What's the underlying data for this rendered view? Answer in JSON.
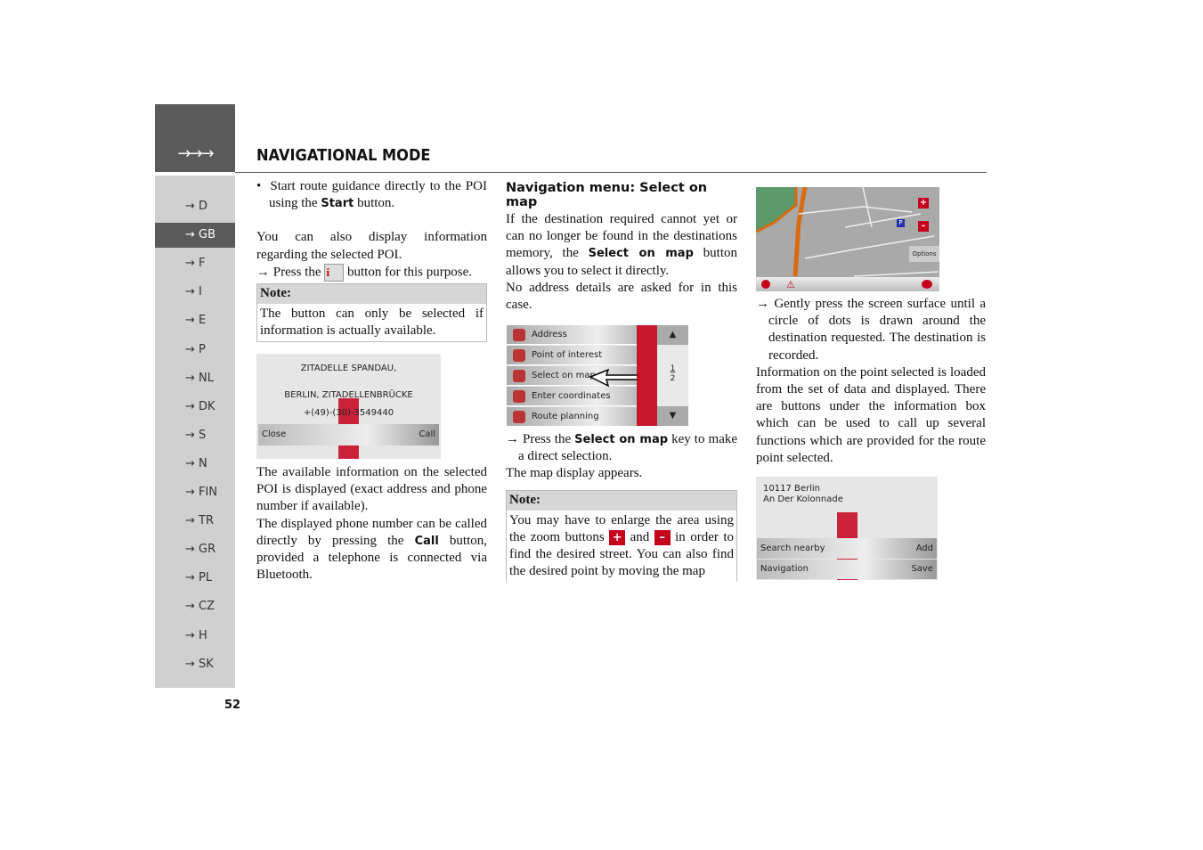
{
  "header": {
    "arrows": "→→→",
    "title": "NAVIGATIONAL MODE"
  },
  "sidebar": {
    "items": [
      "→ D",
      "→ GB",
      "→ F",
      "→ I",
      "→ E",
      "→ P",
      "→ NL",
      "→ DK",
      "→ S",
      "→ N",
      "→ FIN",
      "→ TR",
      "→ GR",
      "→ PL",
      "→ CZ",
      "→ H",
      "→ SK"
    ],
    "active": "→ GB"
  },
  "page_number": "52",
  "col1": {
    "bullet_pre": "Start route guidance directly to the POI using the ",
    "bullet_bold": "Start",
    "bullet_post": " button.",
    "p1": "You can also display information regarding the selected POI.",
    "p2_pre": "→ Press the ",
    "info_icon": "i",
    "p2_post": " button for this purpose.",
    "note_title": "Note:",
    "note_body": "The button can only be selected if information is actually available.",
    "poi_box": {
      "line1": "ZITADELLE SPANDAU,",
      "line2": "BERLIN, ZITADELLENBRÜCKE",
      "phone": "+(49)-(30)-3549440",
      "close": "Close",
      "call": "Call"
    },
    "p3": "The available information on the selected POI is displayed (exact address and phone number if available).",
    "p4_pre": "The displayed phone number can be called directly by pressing the ",
    "p4_bold": "Call",
    "p4_post": " button, provided a telephone is connected via Bluetooth."
  },
  "col2": {
    "heading": "Navigation menu: Select on map",
    "p1_pre": "If the destination required cannot yet or can no longer be found in the destinations memory, the ",
    "p1_bold": "Select on map",
    "p1_post": " button allows you to select it directly.",
    "p2": "No address details are asked for in this case.",
    "menu": {
      "items": [
        "Address",
        "Point of interest",
        "Select on map",
        "Enter coordinates",
        "Route planning"
      ],
      "page": "1",
      "pages": "2",
      "up": "▲",
      "down": "▼"
    },
    "step_pre": "→ Press the ",
    "step_bold": "Select on map",
    "step_post": " key to make a direct selection.",
    "p3": "The map display appears.",
    "note_title": "Note:",
    "note_pre": "You may have to enlarge the area using the zoom buttons ",
    "plus": "+",
    "note_and": " and ",
    "minus": "–",
    "note_post": " in order to find the desired street. You can also find the desired point by moving the map"
  },
  "col3": {
    "map": {
      "options": "Options",
      "plus": "+",
      "minus": "–",
      "parking": "P"
    },
    "step": "→ Gently press the screen surface until a circle of dots is drawn around the destination requested. The destination is recorded.",
    "p1": "Information on the point selected is loaded from the set of data and displayed. There are buttons under the information box which can be used to call up several functions which are provided for the route point selected.",
    "info_box": {
      "line1": "10117 Berlin",
      "line2": "An Der Kolonnade",
      "search_nearby": "Search nearby",
      "add": "Add",
      "navigation": "Navigation",
      "save": "Save"
    }
  },
  "colors": {
    "accent_red": "#c4001a",
    "header_gray": "#5a5a5a",
    "sidebar_gray": "#d0d0d0"
  }
}
